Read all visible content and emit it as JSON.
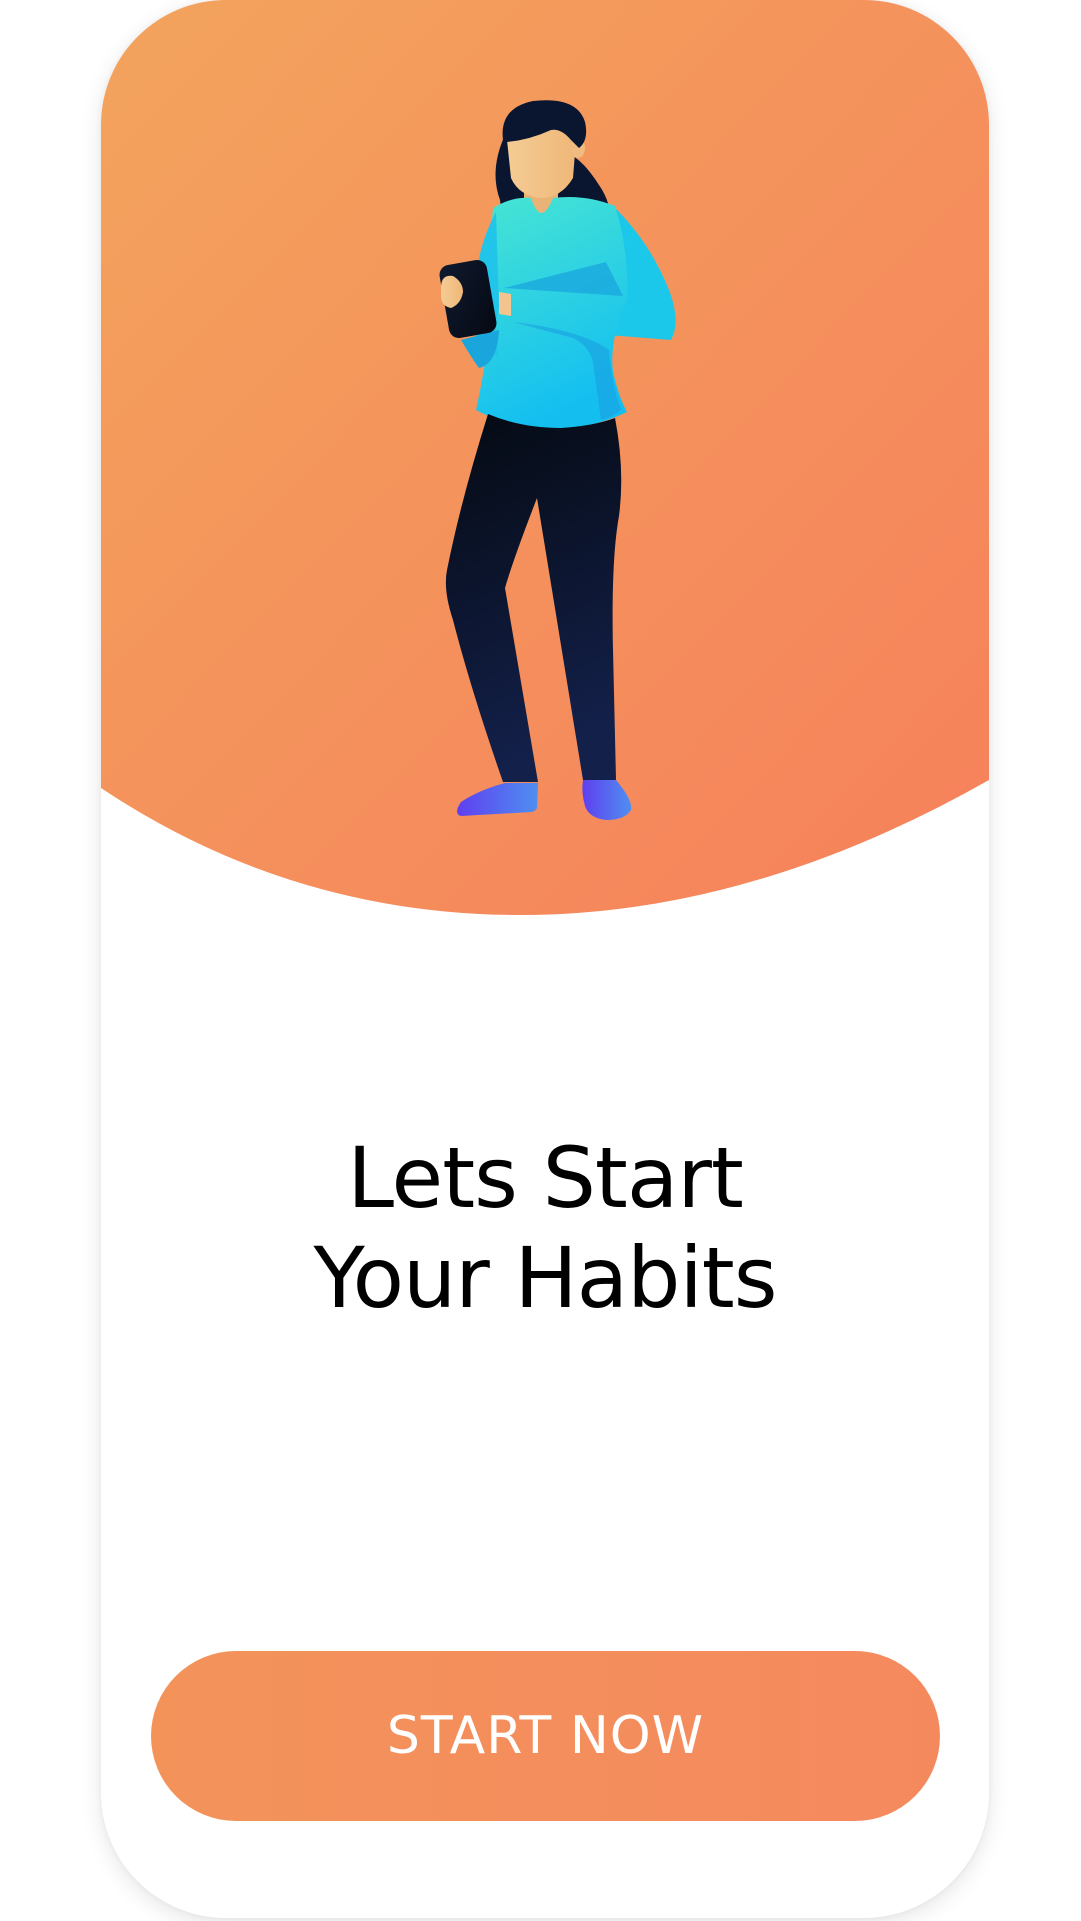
{
  "onboarding": {
    "headline_line1": "Lets Start",
    "headline_line2": "Your Habits",
    "cta_label": "START NOW"
  },
  "colors": {
    "hero_gradient_start": "#f3a45d",
    "hero_gradient_end": "#f5825b",
    "cta_background": "#f48c5c",
    "cta_text": "#ffffff",
    "headline_text": "#000000",
    "shirt": "#2ad4e6",
    "pants": "#0d1a38",
    "shoes": "#5b5ef2",
    "hair": "#0a1530",
    "skin": "#f3c48d"
  },
  "icons": {
    "illustration": "woman-holding-phone-illustration"
  }
}
